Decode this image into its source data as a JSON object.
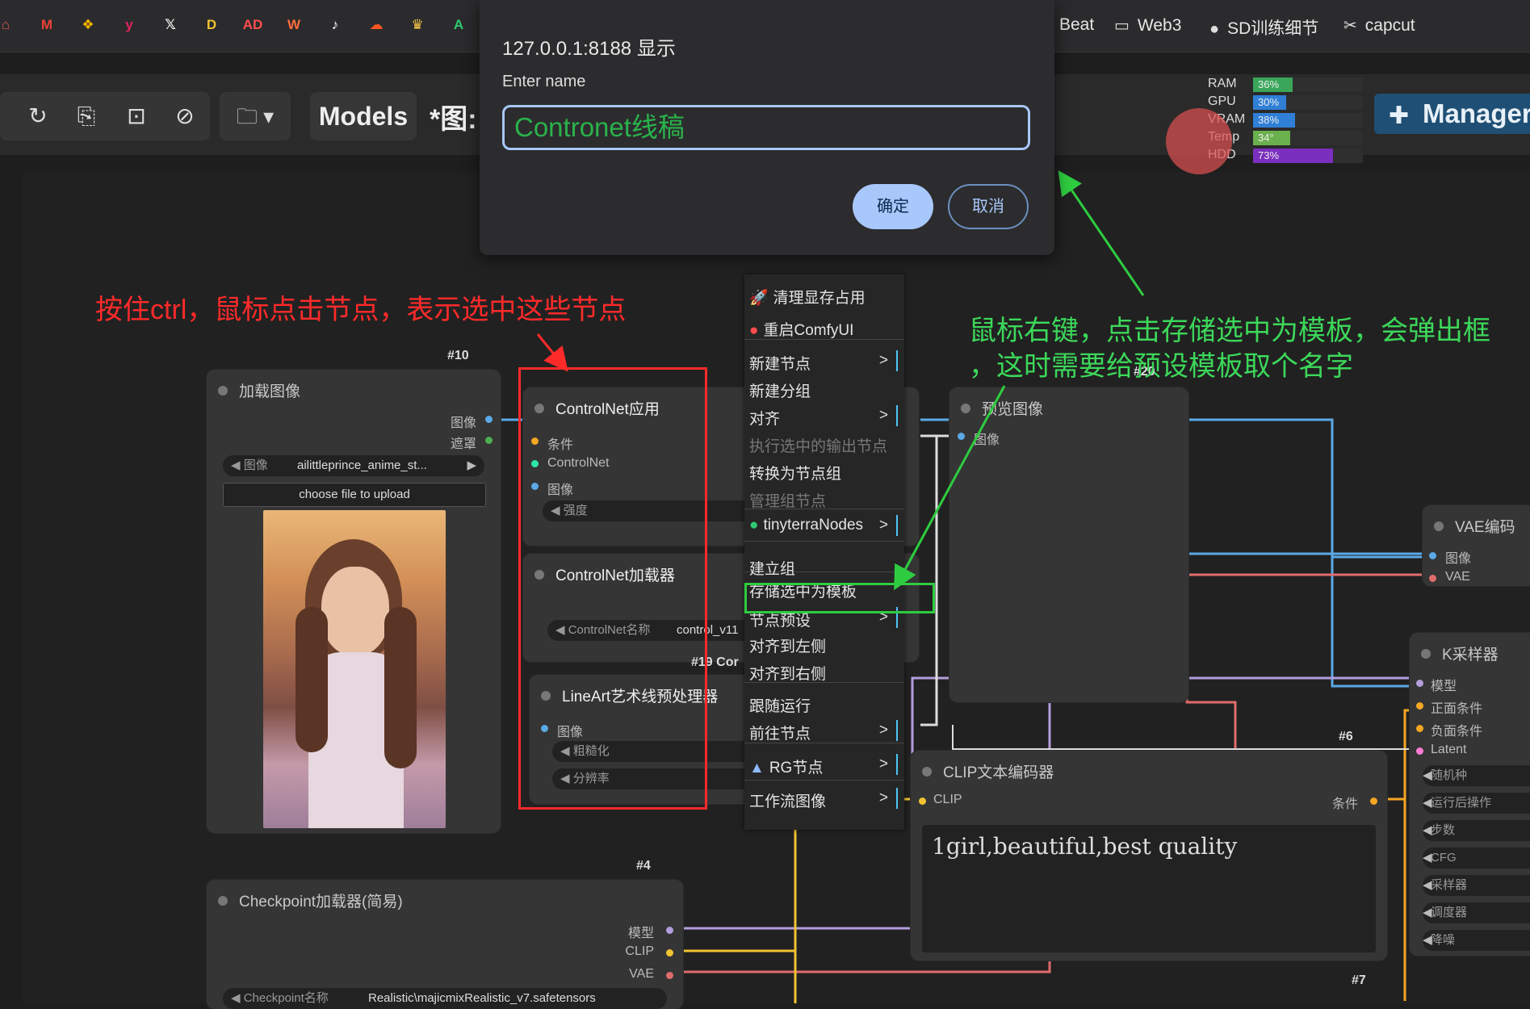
{
  "bookmarks": {
    "icons": [
      {
        "name": "app-icon",
        "glyph": "⌂",
        "color": "#e0584d"
      },
      {
        "name": "gmail-icon",
        "glyph": "M",
        "color": "#ea4335"
      },
      {
        "name": "photos-icon",
        "glyph": "❖",
        "color": "#f4b400"
      },
      {
        "name": "y-icon",
        "glyph": "y",
        "color": "#e0245e"
      },
      {
        "name": "x-icon",
        "glyph": "𝕏",
        "color": "#ffffff"
      },
      {
        "name": "d-icon",
        "glyph": "D",
        "color": "#f1c232"
      },
      {
        "name": "ad-icon",
        "glyph": "AD",
        "color": "#ff4d4d"
      },
      {
        "name": "wave-icon",
        "glyph": "W",
        "color": "#ff6f3c"
      },
      {
        "name": "tiktok-icon",
        "glyph": "♪",
        "color": "#ffffff"
      },
      {
        "name": "cloud-icon",
        "glyph": "☁",
        "color": "#ff5722"
      },
      {
        "name": "crown-icon",
        "glyph": "♛",
        "color": "#f7c948"
      },
      {
        "name": "character-icon",
        "glyph": "A",
        "color": "#2ecc71"
      }
    ],
    "items": [
      {
        "label": "Beat",
        "glyph": ""
      },
      {
        "label": "Web3",
        "glyph": "▭"
      },
      {
        "label": "SD训练细节",
        "glyph": "●"
      },
      {
        "label": "capcut",
        "glyph": "✂"
      }
    ]
  },
  "toolbar": {
    "refresh_icon": "↻",
    "clipboard_icon": "⎘",
    "fit_icon": "⊡",
    "cancel_icon": "⊘",
    "folder_icon": "🗀 ▾",
    "models_tab": "Models",
    "workflow_tab": "*图:"
  },
  "stats": [
    {
      "label": "RAM",
      "value": "36%",
      "pct": 36,
      "color": "#3aa65a"
    },
    {
      "label": "GPU",
      "value": "30%",
      "pct": 30,
      "color": "#2f7fd6"
    },
    {
      "label": "VRAM",
      "value": "38%",
      "pct": 38,
      "color": "#2f7fd6"
    },
    {
      "label": "Temp",
      "value": "34°",
      "pct": 34,
      "color": "#6ab04c"
    },
    {
      "label": "HDD",
      "value": "73%",
      "pct": 73,
      "color": "#7b2fbf"
    }
  ],
  "manager": {
    "label": "Manager",
    "icon": "✚"
  },
  "dialog": {
    "title": "127.0.0.1:8188 显示",
    "label": "Enter name",
    "input_value": "Contronet线稿",
    "ok": "确定",
    "cancel": "取消"
  },
  "annotations": {
    "red": "按住ctrl，鼠标点击节点，表示选中这些节点",
    "green_line1": "鼠标右键，点击存储选中为模板，会弹出框",
    "green_line2": "，这时需要给预设模板取个名字"
  },
  "context_menu": [
    {
      "label": "清理显存占用",
      "icon": "rocket-icon",
      "glyph": "🚀",
      "arrow": ""
    },
    {
      "label": "重启ComfyUI",
      "icon": "restart-icon",
      "glyph": "●",
      "arrow": ""
    },
    {
      "label": "新建节点",
      "arrow": ">"
    },
    {
      "label": "新建分组",
      "arrow": ""
    },
    {
      "label": "对齐",
      "arrow": ">"
    },
    {
      "label": "执行选中的输出节点",
      "arrow": "",
      "disabled": true
    },
    {
      "label": "转换为节点组",
      "arrow": ""
    },
    {
      "label": "管理组节点",
      "arrow": "",
      "disabled": true
    },
    {
      "label": "tinyterraNodes",
      "icon": "globe-icon",
      "glyph": "●",
      "arrow": ">"
    },
    {
      "label": "建立组",
      "arrow": ""
    },
    {
      "label": "存储选中为模板",
      "arrow": ""
    },
    {
      "label": "节点预设",
      "arrow": ">"
    },
    {
      "label": "对齐到左侧",
      "arrow": ""
    },
    {
      "label": "对齐到右侧",
      "arrow": ""
    },
    {
      "label": "跟随运行",
      "arrow": ""
    },
    {
      "label": "前往节点",
      "arrow": ">"
    },
    {
      "label": "RG节点",
      "icon": "rg-icon",
      "glyph": "▲",
      "arrow": ">"
    },
    {
      "label": "工作流图像",
      "arrow": ">"
    }
  ],
  "nodes": {
    "load_image": {
      "id": "#10",
      "title": "加载图像",
      "out_image": "图像",
      "out_mask": "遮罩",
      "widget_label": "图像",
      "widget_value": "ailittleprince_anime_st...",
      "upload": "choose file to upload"
    },
    "controlnet_apply": {
      "title": "ControlNet应用",
      "in_cond": "条件",
      "in_cn": "ControlNet",
      "in_image": "图像",
      "w_strength": "强度"
    },
    "controlnet_loader": {
      "title": "ControlNet加载器",
      "w_label": "ControlNet名称",
      "w_value": "control_v11",
      "id_label": "#19 Cor"
    },
    "lineart": {
      "title": "LineArt艺术线预处理器",
      "in_image": "图像",
      "w1": "粗糙化",
      "w2": "分辨率"
    },
    "preview": {
      "id": "#20",
      "title": "预览图像",
      "in_image": "图像"
    },
    "vae_encode": {
      "title": "VAE编码",
      "in_image": "图像",
      "in_vae": "VAE"
    },
    "ksampler": {
      "title": "K采样器",
      "in_model": "模型",
      "in_pos": "正面条件",
      "in_neg": "负面条件",
      "in_latent": "Latent",
      "widgets": [
        "随机种",
        "运行后操作",
        "步数",
        "CFG",
        "采样器",
        "调度器",
        "降噪"
      ]
    },
    "clip_text": {
      "id": "#6",
      "title": "CLIP文本编码器",
      "in_clip": "CLIP",
      "out_cond": "条件",
      "text": "1girl,beautiful,best quality"
    },
    "checkpoint": {
      "id": "#4",
      "title": "Checkpoint加载器(简易)",
      "out_model": "模型",
      "out_clip": "CLIP",
      "out_vae": "VAE",
      "w_label": "Checkpoint名称",
      "w_value": "Realistic\\majicmixRealistic_v7.safetensors"
    },
    "id7": "#7"
  }
}
